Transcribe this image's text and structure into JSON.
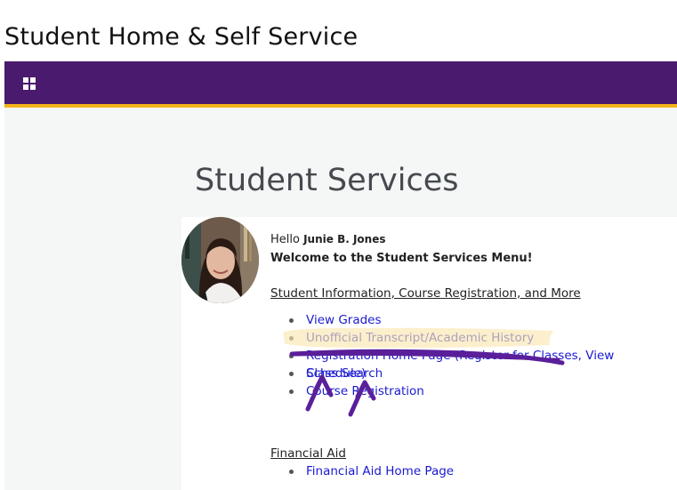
{
  "page": {
    "title": "Student Home & Self Service"
  },
  "navbar": {
    "icon": "apps-grid-icon",
    "bg_color": "#4a1a6e",
    "accent_color": "#f2b31a"
  },
  "main": {
    "heading": "Student Services",
    "greeting_prefix": "Hello",
    "user_name": "Junie B. Jones",
    "welcome": "Welcome to the Student Services Menu!",
    "section_title": "Student Information, Course Registration, and More",
    "links": [
      {
        "label": "View Grades"
      },
      {
        "label": "Unofficial Transcript/Academic History"
      },
      {
        "label": "Registration Home Page (Register for Classes, View Schedule)"
      },
      {
        "label": "Class Search"
      },
      {
        "label": "Course Registration"
      }
    ],
    "financial_title": "Financial Aid",
    "financial_links": [
      {
        "label": "Financial Aid Home Page"
      }
    ]
  },
  "annotations": {
    "highlight_color": "#fbe7b0",
    "ink_color": "#5a1f9a"
  }
}
